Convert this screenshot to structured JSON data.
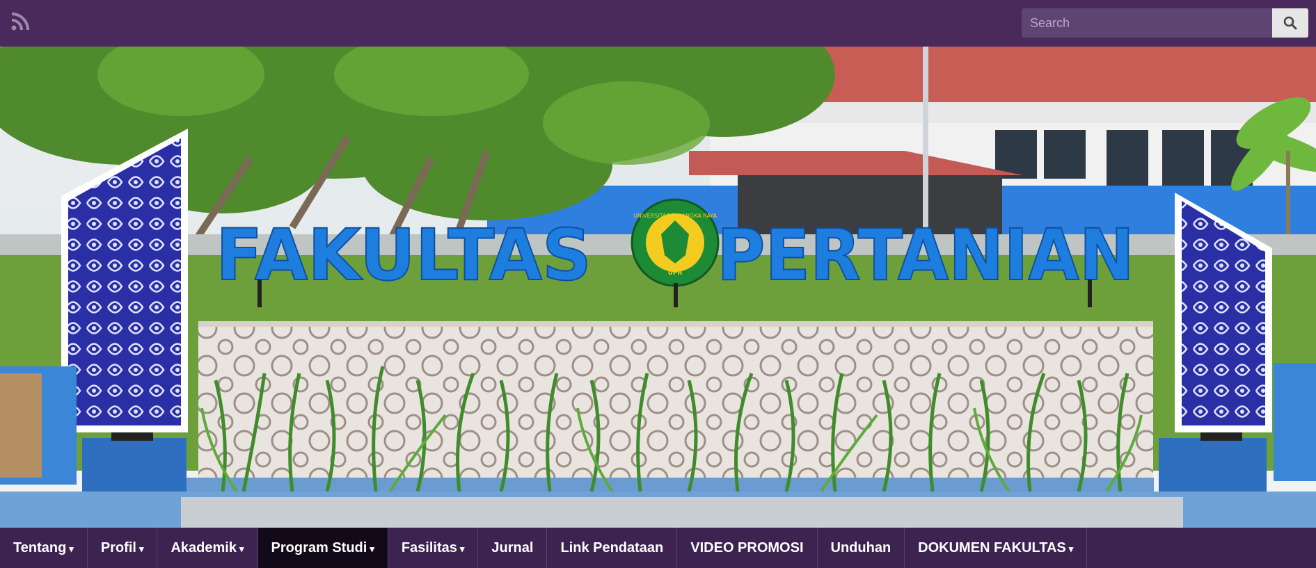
{
  "topbar": {
    "rss_icon": "rss-icon",
    "search": {
      "placeholder": "Search",
      "value": "",
      "button_icon": "search-icon"
    }
  },
  "hero": {
    "sign_left": "FAKULTAS",
    "sign_right": "PERTANIAN",
    "emblem_text_top": "UNIVERSITAS PALANGKA RAYA",
    "emblem_text_bottom": "UPR"
  },
  "nav": {
    "items": [
      {
        "label": "Tentang",
        "has_dropdown": true,
        "active": false
      },
      {
        "label": "Profil",
        "has_dropdown": true,
        "active": false
      },
      {
        "label": "Akademik",
        "has_dropdown": true,
        "active": false
      },
      {
        "label": "Program Studi",
        "has_dropdown": true,
        "active": true
      },
      {
        "label": "Fasilitas",
        "has_dropdown": true,
        "active": false
      },
      {
        "label": "Jurnal",
        "has_dropdown": false,
        "active": false
      },
      {
        "label": "Link Pendataan",
        "has_dropdown": false,
        "active": false
      },
      {
        "label": "VIDEO PROMOSI",
        "has_dropdown": false,
        "active": false
      },
      {
        "label": "Unduhan",
        "has_dropdown": false,
        "active": false
      },
      {
        "label": "DOKUMEN FAKULTAS",
        "has_dropdown": true,
        "active": false
      }
    ]
  },
  "colors": {
    "topbar_bg": "#4a2a5c",
    "nav_bg": "#3c2350",
    "nav_active_bg": "#120a18",
    "sign_blue": "#1e7ee0"
  }
}
